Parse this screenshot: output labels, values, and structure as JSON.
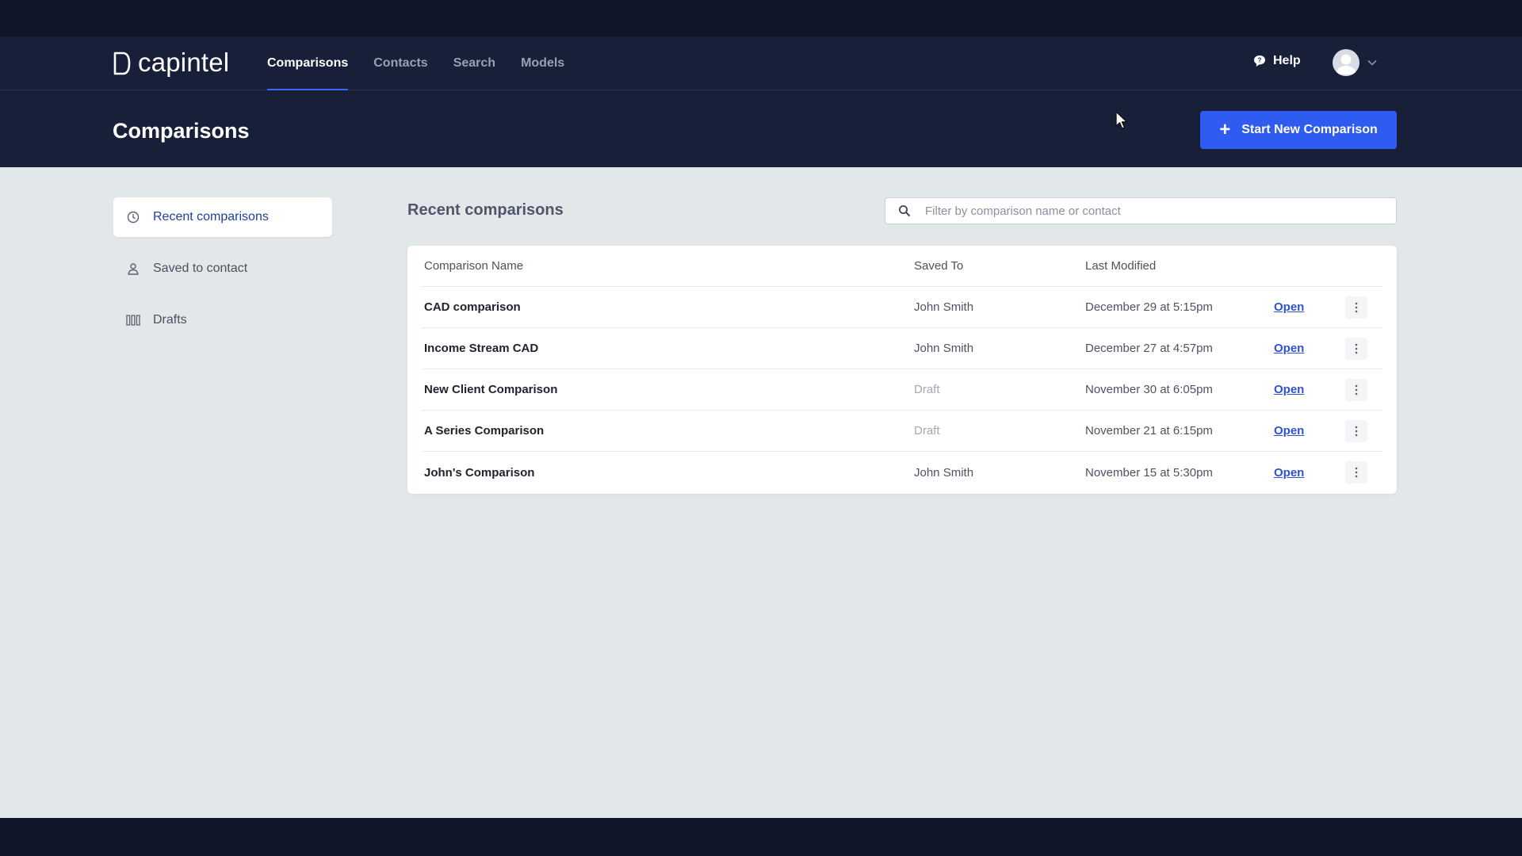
{
  "app": {
    "logo_text": "capintel",
    "nav": [
      {
        "label": "Comparisons",
        "active": true
      },
      {
        "label": "Contacts",
        "active": false
      },
      {
        "label": "Search",
        "active": false
      },
      {
        "label": "Models",
        "active": false
      }
    ],
    "help_label": "Help"
  },
  "header": {
    "title": "Comparisons",
    "new_button_label": "Start New Comparison"
  },
  "sidebar": {
    "items": [
      {
        "label": "Recent comparisons",
        "icon": "clock-icon",
        "active": true
      },
      {
        "label": "Saved to contact",
        "icon": "person-icon",
        "active": false
      },
      {
        "label": "Drafts",
        "icon": "drafts-icon",
        "active": false
      }
    ]
  },
  "main": {
    "section_title": "Recent comparisons",
    "filter_placeholder": "Filter by comparison name or contact",
    "columns": [
      "Comparison Name",
      "Saved To",
      "Last Modified"
    ],
    "rows": [
      {
        "name": "CAD comparison",
        "saved_to": "John Smith",
        "modified": "December 29 at 5:15pm",
        "action": "Open"
      },
      {
        "name": "Income Stream CAD",
        "saved_to": "John Smith",
        "modified": "December 27 at 4:57pm",
        "action": "Open"
      },
      {
        "name": "New Client Comparison",
        "saved_to": "Draft",
        "modified": "November 30 at 6:05pm",
        "action": "Open"
      },
      {
        "name": "A Series Comparison",
        "saved_to": "Draft",
        "modified": "November 21 at 6:15pm",
        "action": "Open"
      },
      {
        "name": "John's Comparison",
        "saved_to": "John Smith",
        "modified": "November 15 at 5:30pm",
        "action": "Open"
      }
    ]
  },
  "colors": {
    "header_bg": "#182039",
    "accent": "#2f5bf0",
    "link": "#2e52d6",
    "page_bg": "#e2e7ea"
  }
}
